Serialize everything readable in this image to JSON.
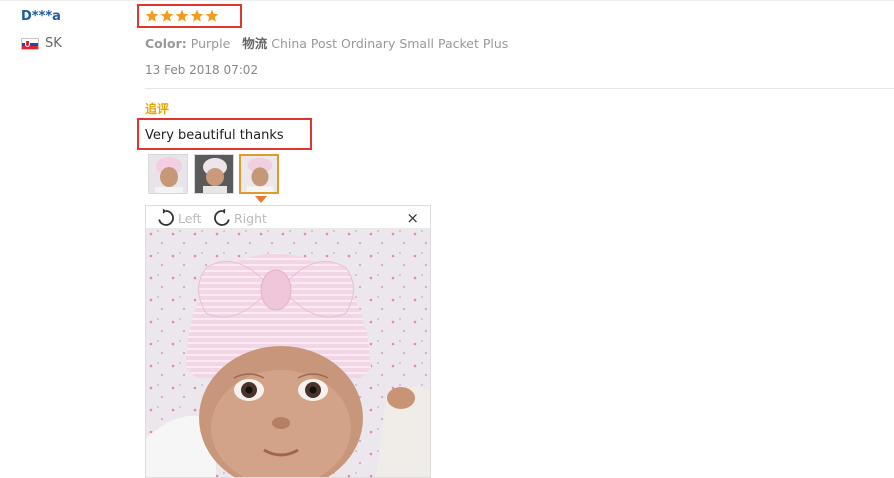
{
  "reviewer": {
    "name": "D***a",
    "country": "SK"
  },
  "review": {
    "rating": 5,
    "color_label": "Color:",
    "color_value": "Purple",
    "shipping_label": "物流",
    "shipping_value": "China Post Ordinary Small Packet Plus",
    "date": "13 Feb 2018 07:02",
    "followup_label": "追评",
    "text": "Very beautiful thanks",
    "thumbnails": [
      "photo-1",
      "photo-2",
      "photo-3"
    ],
    "active_thumbnail": 3
  },
  "viewer": {
    "rotate_left_label": "Left",
    "rotate_right_label": "Right",
    "close_icon": "×"
  },
  "colors": {
    "accent_red": "#e0342f",
    "star": "#f39b1d",
    "followup": "#e6a400",
    "name_link": "#1a5aa8"
  }
}
